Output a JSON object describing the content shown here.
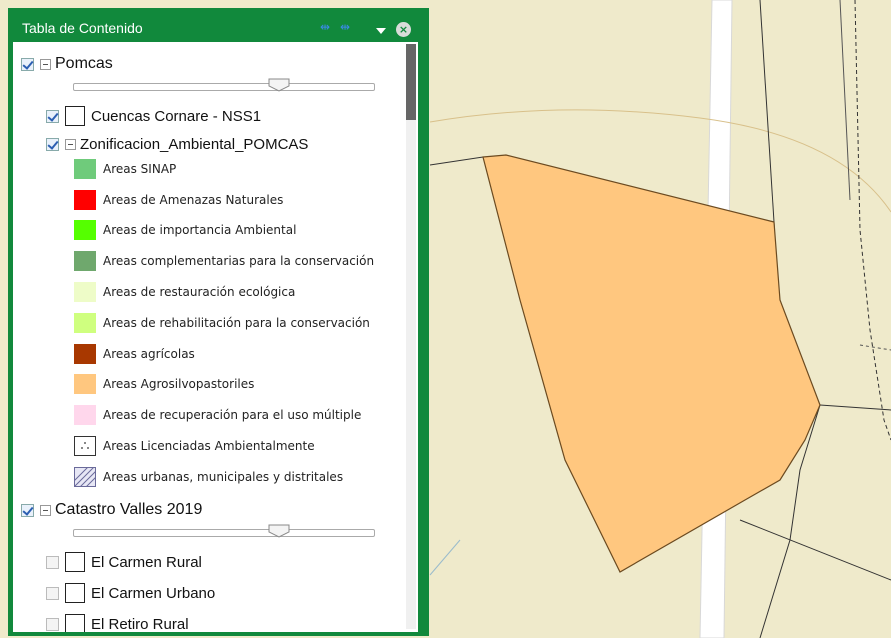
{
  "toc": {
    "title": "Tabla de Contenido",
    "icons": [
      "expand-all-icon",
      "collapse-all-icon",
      "menu-arrow-icon",
      "close-icon"
    ],
    "close_label": "×",
    "groups": [
      {
        "label": "Pomcas",
        "checked": true,
        "opacity_fraction": 0.7,
        "layers": [
          {
            "label": "Cuencas Cornare - NSS1",
            "checked": true
          },
          {
            "label": "Zonificacion_Ambiental_POMCAS",
            "checked": true,
            "legend": [
              {
                "label": "Areas SINAP",
                "color": "#6fcb7b"
              },
              {
                "label": "Areas de Amenazas Naturales",
                "color": "#ff0000"
              },
              {
                "label": "Areas de importancia Ambiental",
                "color": "#55ff00"
              },
              {
                "label": "Areas complementarias para la conservación",
                "color": "#6fa86d"
              },
              {
                "label": "Areas de restauración ecológica",
                "color": "#eefcc8"
              },
              {
                "label": "Areas de rehabilitación para la conservación",
                "color": "#cfff7f"
              },
              {
                "label": "Areas agrícolas",
                "color": "#a83800"
              },
              {
                "label": "Areas Agrosilvopastoriles",
                "color": "#ffc77f"
              },
              {
                "label": "Areas de recuperación para el uso múltiple",
                "color": "#ffd7ec"
              },
              {
                "label": "Areas Licenciadas Ambientalmente",
                "color": "#ffffff"
              },
              {
                "label": "Areas urbanas, municipales y distritales",
                "color": "#e7e7f5"
              }
            ]
          }
        ]
      },
      {
        "label": "Catastro Valles 2019",
        "checked": true,
        "opacity_fraction": 0.7,
        "layers": [
          {
            "label": "El Carmen Rural",
            "checked": false
          },
          {
            "label": "El Carmen Urbano",
            "checked": false
          },
          {
            "label": "El Retiro Rural",
            "checked": false
          }
        ]
      }
    ]
  },
  "map": {
    "background_color": "#efeacb",
    "polygon_fill": "#ffc77f",
    "road_color": "#ffffff"
  }
}
